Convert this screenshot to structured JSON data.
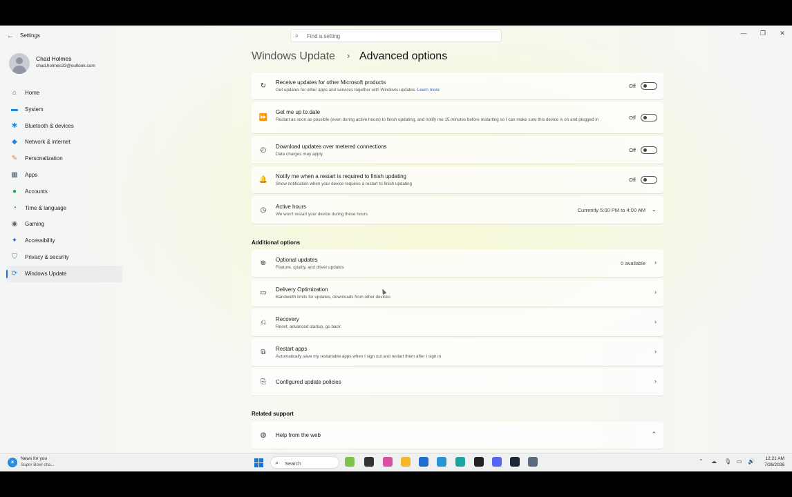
{
  "window": {
    "title": "Settings",
    "search_placeholder": "Find a setting",
    "back_glyph": "←",
    "minimize_glyph": "—",
    "maximize_glyph": "❐",
    "close_glyph": "✕"
  },
  "profile": {
    "name": "Chad Holmes",
    "email": "chad.holmes33@outlook.com"
  },
  "sidebar": {
    "items": [
      {
        "label": "Home",
        "icon": "home-icon",
        "glyph": "⌂",
        "color": "#555555"
      },
      {
        "label": "System",
        "icon": "system-icon",
        "glyph": "▬",
        "color": "#1e88e5"
      },
      {
        "label": "Bluetooth & devices",
        "icon": "bluetooth-icon",
        "glyph": "✱",
        "color": "#1e88e5"
      },
      {
        "label": "Network & internet",
        "icon": "wifi-icon",
        "glyph": "◆",
        "color": "#2a7de1"
      },
      {
        "label": "Personalization",
        "icon": "brush-icon",
        "glyph": "✎",
        "color": "#e3862b"
      },
      {
        "label": "Apps",
        "icon": "apps-icon",
        "glyph": "▦",
        "color": "#4a5d78"
      },
      {
        "label": "Accounts",
        "icon": "accounts-icon",
        "glyph": "●",
        "color": "#27a05a"
      },
      {
        "label": "Time & language",
        "icon": "clock-icon",
        "glyph": "◔",
        "color": "#2a7de1"
      },
      {
        "label": "Gaming",
        "icon": "gaming-icon",
        "glyph": "◉",
        "color": "#666666"
      },
      {
        "label": "Accessibility",
        "icon": "accessibility-icon",
        "glyph": "✦",
        "color": "#1e6fd1"
      },
      {
        "label": "Privacy & security",
        "icon": "shield-icon",
        "glyph": "⛉",
        "color": "#6b7683"
      },
      {
        "label": "Windows Update",
        "icon": "update-icon",
        "glyph": "⟳",
        "color": "#1e88e5",
        "active": true
      }
    ]
  },
  "header": {
    "parent": "Windows Update",
    "separator": "›",
    "current": "Advanced options"
  },
  "settings": [
    {
      "title": "Receive updates for other Microsoft products",
      "desc": "Get updates for other apps and services together with Windows updates.",
      "link": "Learn more",
      "state": "Off",
      "icon": "refresh-icon",
      "glyph": "↻"
    },
    {
      "title": "Get me up to date",
      "desc": "Restart as soon as possible (even during active hours) to finish updating, and notify me 15 minutes before restarting so I can make sure this device is on and plugged in",
      "state": "Off",
      "icon": "fast-forward-icon",
      "glyph": "⏩"
    },
    {
      "title": "Download updates over metered connections",
      "desc": "Data charges may apply",
      "state": "Off",
      "icon": "gauge-icon",
      "glyph": "◴"
    },
    {
      "title": "Notify me when a restart is required to finish updating",
      "desc": "Show notification when your device requires a restart to finish updating",
      "state": "Off",
      "icon": "bell-icon",
      "glyph": "🔔"
    },
    {
      "title": "Active hours",
      "desc": "We won't restart your device during these hours",
      "value": "Currently 5:00 PM to 4:00 AM",
      "icon": "active-hours-icon",
      "glyph": "◷"
    }
  ],
  "additional": {
    "heading": "Additional options",
    "items": [
      {
        "title": "Optional updates",
        "desc": "Feature, quality, and driver updates",
        "value": "0 available",
        "icon": "plus-circle-icon",
        "glyph": "⊕"
      },
      {
        "title": "Delivery Optimization",
        "desc": "Bandwidth limits for updates, downloads from other devices",
        "icon": "delivery-icon",
        "glyph": "▭"
      },
      {
        "title": "Recovery",
        "desc": "Reset, advanced startup, go back",
        "icon": "recovery-icon",
        "glyph": "⎌"
      },
      {
        "title": "Restart apps",
        "desc": "Automatically save my restartable apps when I sign out and restart them after I sign in",
        "icon": "restart-apps-icon",
        "glyph": "⧉"
      },
      {
        "title": "Configured update policies",
        "desc": "",
        "icon": "policy-icon",
        "glyph": "⎘"
      }
    ]
  },
  "related": {
    "heading": "Related support",
    "items": [
      {
        "title": "Help from the web",
        "icon": "globe-icon",
        "glyph": "◍"
      }
    ]
  },
  "taskbar": {
    "news_title": "News for you",
    "news_sub": "Super Bowl cha...",
    "search_label": "Search",
    "time": "12:21 AM",
    "date": "7/26/2026",
    "apps": [
      {
        "name": "explorer-thumbnail-icon",
        "color": "#7dc24b"
      },
      {
        "name": "taskview-icon",
        "color": "#333333"
      },
      {
        "name": "copilot-icon",
        "color": "#d94fa1"
      },
      {
        "name": "file-explorer-icon",
        "color": "#f2b72c"
      },
      {
        "name": "store-icon",
        "color": "#1e6fd1"
      },
      {
        "name": "paint-icon",
        "color": "#2a93d5"
      },
      {
        "name": "edge-icon",
        "color": "#1ba5a0"
      },
      {
        "name": "xbox-icon",
        "color": "#222222"
      },
      {
        "name": "discord-icon",
        "color": "#5865f2"
      },
      {
        "name": "steam-icon",
        "color": "#1b2838"
      },
      {
        "name": "settings-app-icon",
        "color": "#5a6b7d"
      }
    ]
  },
  "chev_right": "›",
  "chev_down": "⌄",
  "chev_up": "⌃"
}
